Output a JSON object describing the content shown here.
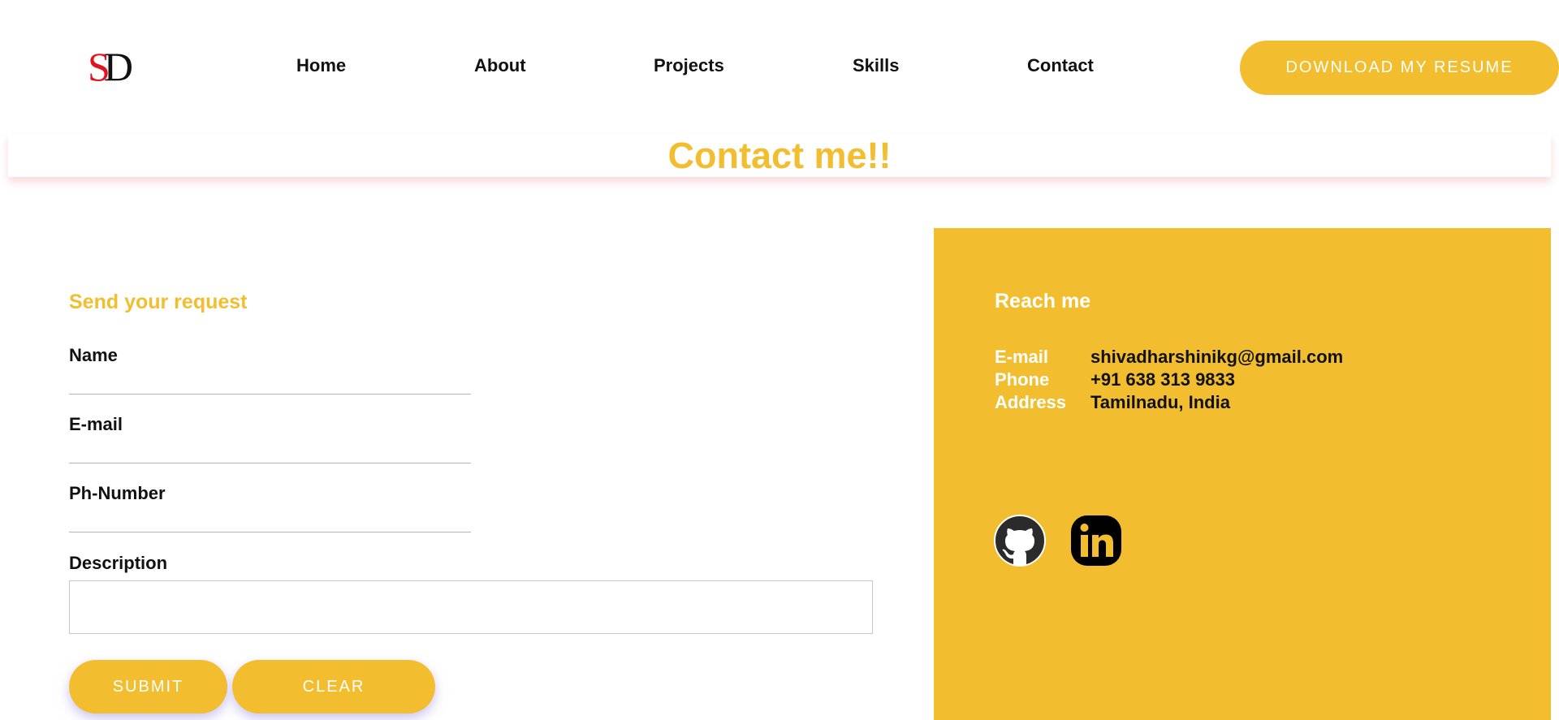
{
  "logo": {
    "first_letter": "S",
    "second_letter": "D"
  },
  "nav": {
    "items": [
      {
        "label": "Home"
      },
      {
        "label": "About"
      },
      {
        "label": "Projects"
      },
      {
        "label": "Skills"
      },
      {
        "label": "Contact"
      }
    ],
    "resume_button": "DOWNLOAD MY RESUME"
  },
  "page": {
    "title": "Contact me!!"
  },
  "form": {
    "heading": "Send your request",
    "name_label": "Name",
    "name_value": "",
    "email_label": "E-mail",
    "email_value": "",
    "phone_label": "Ph-Number",
    "phone_value": "",
    "description_label": "Description",
    "description_value": "",
    "submit_label": "SUBMIT",
    "clear_label": "CLEAR"
  },
  "reach": {
    "heading": "Reach me",
    "rows": [
      {
        "key": "E-mail",
        "value": "shivadharshinikg@gmail.com"
      },
      {
        "key": "Phone",
        "value": "+91 638 313 9833"
      },
      {
        "key": "Address",
        "value": "Tamilnadu, India"
      }
    ],
    "social_icons": [
      "github-icon",
      "linkedin-icon"
    ]
  },
  "colors": {
    "accent": "#f2be2f",
    "logo_red": "#e0141e",
    "text_dark": "#111111",
    "panel_text": "#ffffff"
  }
}
